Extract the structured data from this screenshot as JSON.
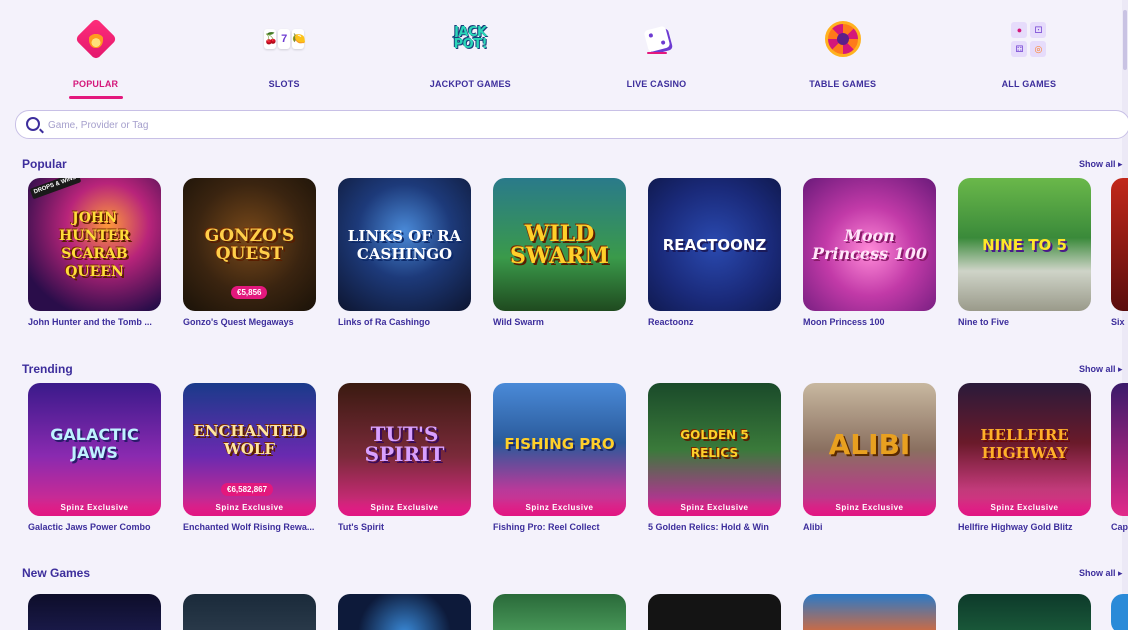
{
  "nav": {
    "items": [
      {
        "label": "POPULAR",
        "icon": "fire-icon",
        "active": true
      },
      {
        "label": "SLOTS",
        "icon": "slot-reels-icon"
      },
      {
        "label": "JACKPOT GAMES",
        "icon": "jackpot-icon",
        "icon_text": "JACK POT!"
      },
      {
        "label": "LIVE CASINO",
        "icon": "dice-icon"
      },
      {
        "label": "TABLE GAMES",
        "icon": "roulette-icon"
      },
      {
        "label": "ALL GAMES",
        "icon": "grid-icon"
      }
    ],
    "slot_symbols": [
      "🍒",
      "7",
      "🍋"
    ],
    "accent": "#e3187d"
  },
  "search": {
    "placeholder": "Game, Provider or Tag"
  },
  "sections": [
    {
      "title": "Popular",
      "show_all": "Show all ▸",
      "games": [
        {
          "name": "John Hunter and the Tomb ...",
          "logo": "JOHN HUNTER SCARAB QUEEN",
          "ribbon": "DROPS & WINS"
        },
        {
          "name": "Gonzo's Quest Megaways",
          "logo": "GONZO'S QUEST",
          "jackpot": "€5,856"
        },
        {
          "name": "Links of Ra Cashingo",
          "logo": "LINKS OF RA CASHINGO"
        },
        {
          "name": "Wild Swarm",
          "logo": "WILD SWARM"
        },
        {
          "name": "Reactoonz",
          "logo": "REACTOONZ"
        },
        {
          "name": "Moon Princess 100",
          "logo": "Moon Princess 100"
        },
        {
          "name": "Nine to Five",
          "logo": "NINE TO 5"
        }
      ],
      "partial_name": "Six"
    },
    {
      "title": "Trending",
      "show_all": "Show all ▸",
      "games": [
        {
          "name": "Galactic Jaws Power Combo",
          "logo": "GALACTIC JAWS",
          "badge": "Spinz Exclusive"
        },
        {
          "name": "Enchanted Wolf Rising Rewa...",
          "logo": "ENCHANTED WOLF",
          "badge": "Spinz Exclusive",
          "jackpot": "€6,582,867"
        },
        {
          "name": "Tut's Spirit",
          "logo": "TUT'S SPIRIT",
          "badge": "Spinz Exclusive"
        },
        {
          "name": "Fishing Pro: Reel Collect",
          "logo": "FISHING PRO",
          "badge": "Spinz Exclusive"
        },
        {
          "name": "5 Golden Relics: Hold & Win",
          "logo": "GOLDEN 5 RELICS",
          "badge": "Spinz Exclusive"
        },
        {
          "name": "Alibi",
          "logo": "ALIBI",
          "badge": "Spinz Exclusive"
        },
        {
          "name": "Hellfire Highway Gold Blitz",
          "logo": "HELLFIRE HIGHWAY",
          "badge": "Spinz Exclusive"
        }
      ],
      "partial_name": "Cap"
    },
    {
      "title": "New Games",
      "show_all": "Show all ▸"
    }
  ]
}
